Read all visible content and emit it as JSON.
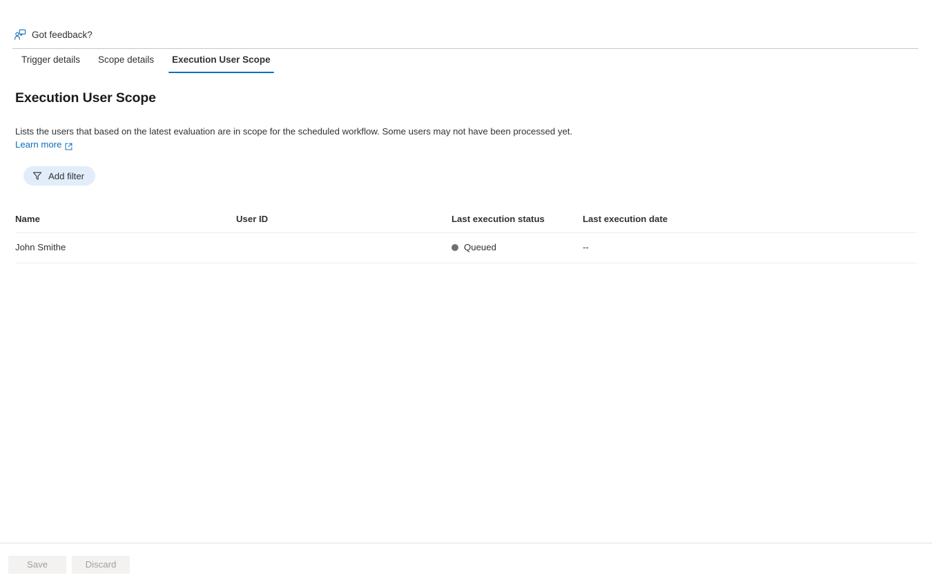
{
  "feedback": {
    "label": "Got feedback?",
    "icon": "person-feedback-icon"
  },
  "tabs": [
    {
      "label": "Trigger details",
      "active": false
    },
    {
      "label": "Scope details",
      "active": false
    },
    {
      "label": "Execution User Scope",
      "active": true
    }
  ],
  "main": {
    "title": "Execution User Scope",
    "description": "Lists the users that based on the latest evaluation are in scope for the scheduled workflow. Some users may not have been processed yet.",
    "learn_more_label": "Learn more",
    "learn_more_icon": "external-link-icon"
  },
  "toolbar": {
    "add_filter_label": "Add filter",
    "filter_icon": "funnel-icon"
  },
  "table": {
    "columns": [
      "Name",
      "User ID",
      "Last execution status",
      "Last execution date"
    ],
    "rows": [
      {
        "name": "John Smithe",
        "user_id": "",
        "status": "Queued",
        "status_color": "#707070",
        "date": "--"
      }
    ]
  },
  "footer": {
    "save_label": "Save",
    "discard_label": "Discard"
  },
  "colors": {
    "accent": "#0f6cbd",
    "link": "#0f6cbd",
    "pill_background": "#e1edfa",
    "status_queued": "#707070",
    "divider": "#edebe9",
    "text": "#323130"
  }
}
